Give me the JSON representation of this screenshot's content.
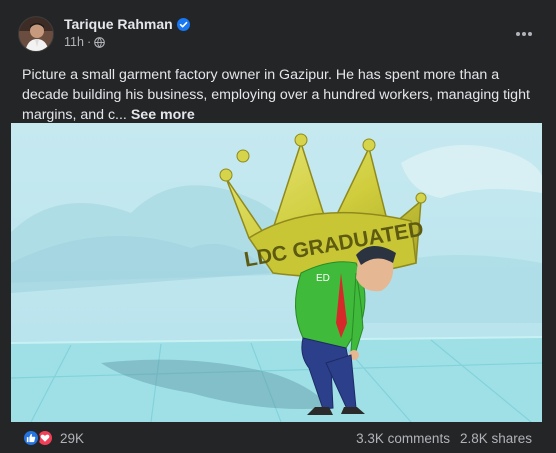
{
  "post": {
    "author": "Tarique Rahman",
    "verified": true,
    "time": "11h",
    "audience_icon": "globe-icon",
    "text": "Picture a small garment factory owner in Gazipur. He has spent more than a decade building his business, employing over a hundred workers, managing tight margins, and c...",
    "see_more": "See more",
    "image": {
      "crown_text": "LDC GRADUATED",
      "shirt_text": "ED"
    },
    "reaction_count": "29K",
    "comments": "3.3K comments",
    "shares": "2.8K shares"
  },
  "colors": {
    "background": "#242526",
    "text_primary": "#e4e6eb",
    "text_secondary": "#b0b3b8",
    "verified_blue": "#1877f2",
    "like_blue": "#2374e1",
    "love_red": "#f33e58"
  }
}
